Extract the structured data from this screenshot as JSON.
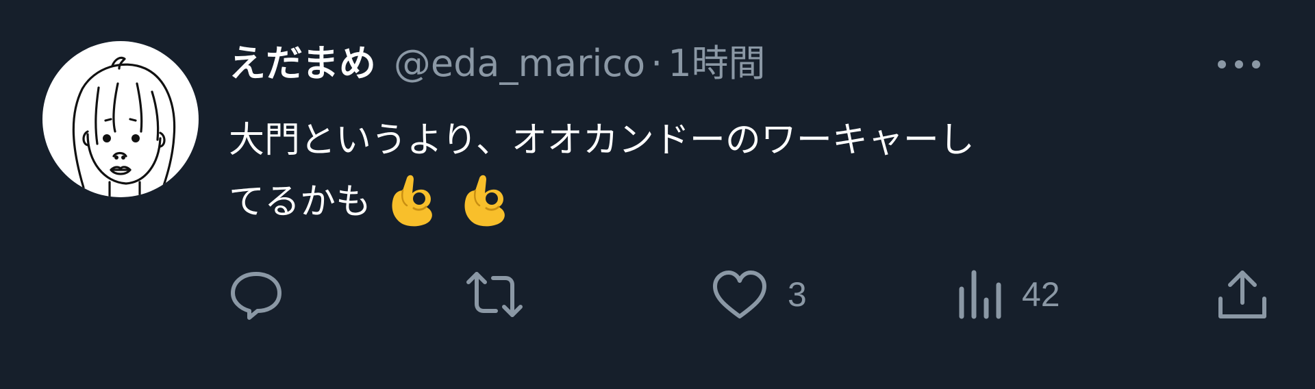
{
  "author": {
    "display_name": "えだまめ",
    "handle": "@eda_marico",
    "separator": "·",
    "time_ago": "1時間"
  },
  "tweet": {
    "text_line1": "大門というより、オオカンドーのワーキャーし",
    "text_line2": "てるかも",
    "emojis": [
      "ok-hand",
      "ok-hand"
    ]
  },
  "actions": {
    "reply_count": "",
    "retweet_count": "",
    "like_count": "3",
    "view_count": "42"
  },
  "colors": {
    "background": "#161f2b",
    "text_primary": "#ffffff",
    "text_secondary": "#8b98a5",
    "emoji_yellow": "#f8bf2b"
  },
  "icons": [
    "more-icon",
    "reply-icon",
    "retweet-icon",
    "like-icon",
    "views-icon",
    "share-icon"
  ]
}
